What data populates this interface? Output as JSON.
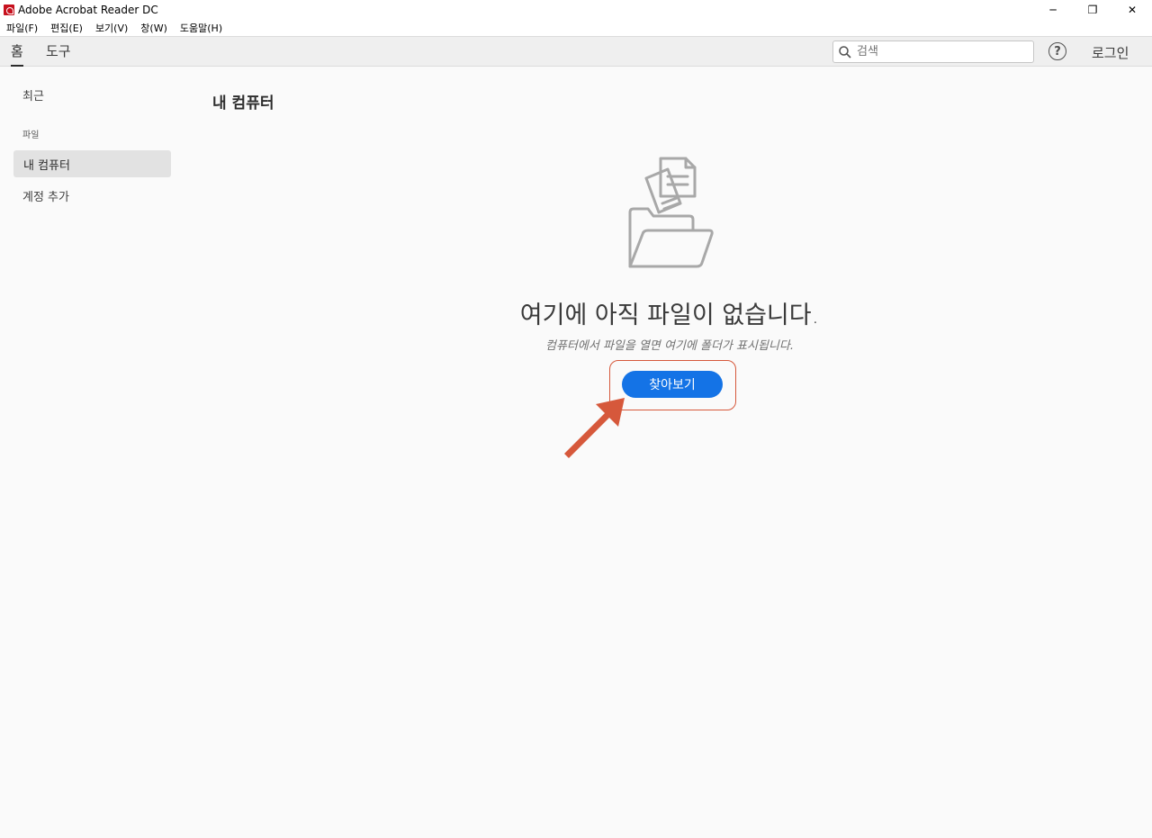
{
  "window": {
    "title": "Adobe Acrobat Reader DC",
    "controls": {
      "minimize": "─",
      "restore": "❐",
      "close": "✕"
    }
  },
  "menu": [
    "파일(F)",
    "편집(E)",
    "보기(V)",
    "창(W)",
    "도움말(H)"
  ],
  "toolbar": {
    "tabs": [
      {
        "label": "홈",
        "active": true
      },
      {
        "label": "도구",
        "active": false
      }
    ],
    "search": {
      "placeholder": "검색",
      "icon": "search-icon"
    },
    "help_icon": "?",
    "login_label": "로그인"
  },
  "sidebar": {
    "recent": "최근",
    "files_section": "파일",
    "my_computer": "내 컴퓨터",
    "add_account": "계정 추가"
  },
  "main": {
    "heading": "내 컴퓨터",
    "empty_title": "여기에 아직 파일이 없습니다.",
    "empty_subtitle": "컴퓨터에서 파일을 열면 여기에 폴더가 표시됩니다.",
    "browse_button": "찾아보기"
  },
  "colors": {
    "accent": "#1473e6",
    "annotation": "#d6583b",
    "background": "#fafafa"
  }
}
